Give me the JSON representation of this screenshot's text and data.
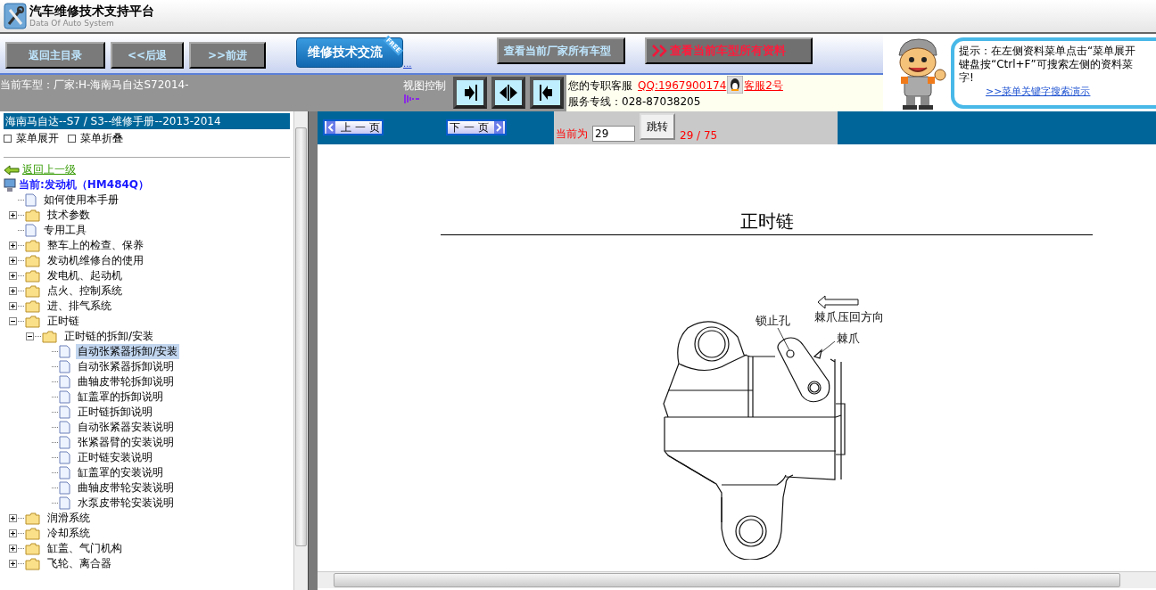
{
  "header": {
    "title": "汽车维修技术支持平台",
    "subtitle": "Data Of Auto System"
  },
  "nav_buttons": [
    {
      "label": "返回主目录"
    },
    {
      "label": "<<后退"
    },
    {
      "label": ">>前进"
    }
  ],
  "forum_button": {
    "label": "维修技术交流",
    "badge": "FREE"
  },
  "more_link": "...",
  "model_buttons": [
    {
      "label": "查看当前厂家所有车型",
      "kind": "plain"
    },
    {
      "label": "查看当前车型所有资料",
      "kind": "highlight"
    }
  ],
  "current_model": "当前车型：厂家:H-海南马自达S72014-",
  "view_control": {
    "label": "视图控制",
    "buttons": [
      {
        "kind": "right"
      },
      {
        "kind": "split"
      },
      {
        "kind": "left"
      }
    ]
  },
  "service": {
    "label": "您的专职客服",
    "qq": "QQ:1967900174",
    "agent": "客服2号",
    "hotline": "服务专线：028-87038205"
  },
  "tip": {
    "lines": [
      "提示：在左侧资料菜单点击“菜单展开",
      "键盘按“Ctrl+F”可搜索左侧的资料菜",
      "字!"
    ],
    "link": ">>菜单关键字搜索演示"
  },
  "sidebar": {
    "manual_title": "海南马自达--S7 / S3--维修手册--2013-2014",
    "actions": [
      "菜单展开",
      "菜单折叠"
    ],
    "back_link": "返回上一级",
    "current": "当前:发动机（HM484Q）",
    "tree": [
      {
        "kind": "doc",
        "label": "如何使用本手册",
        "selected": false
      },
      {
        "kind": "folder",
        "label": "技术参数",
        "expanded": false,
        "selected": false
      },
      {
        "kind": "doc",
        "label": "专用工具",
        "selected": false
      },
      {
        "kind": "folder",
        "label": "整车上的检查、保养",
        "expanded": false,
        "selected": false
      },
      {
        "kind": "folder",
        "label": "发动机维修台的使用",
        "expanded": false,
        "selected": false
      },
      {
        "kind": "folder",
        "label": "发电机、起动机",
        "expanded": false,
        "selected": false
      },
      {
        "kind": "folder",
        "label": "点火、控制系统",
        "expanded": false,
        "selected": false
      },
      {
        "kind": "folder",
        "label": "进、排气系统",
        "expanded": false,
        "selected": false
      },
      {
        "kind": "folder",
        "label": "正时链",
        "expanded": true,
        "selected": false,
        "children": [
          {
            "kind": "folder",
            "label": "正时链的拆卸/安装",
            "expanded": true,
            "selected": false,
            "children": [
              {
                "kind": "doc",
                "label": "自动张紧器拆卸/安装",
                "selected": true
              },
              {
                "kind": "doc",
                "label": "自动张紧器拆卸说明",
                "selected": false
              },
              {
                "kind": "doc",
                "label": "曲轴皮带轮拆卸说明",
                "selected": false
              },
              {
                "kind": "doc",
                "label": "缸盖罩的拆卸说明",
                "selected": false
              },
              {
                "kind": "doc",
                "label": "正时链拆卸说明",
                "selected": false
              },
              {
                "kind": "doc",
                "label": "自动张紧器安装说明",
                "selected": false
              },
              {
                "kind": "doc",
                "label": "张紧器臂的安装说明",
                "selected": false
              },
              {
                "kind": "doc",
                "label": "正时链安装说明",
                "selected": false
              },
              {
                "kind": "doc",
                "label": "缸盖罩的安装说明",
                "selected": false
              },
              {
                "kind": "doc",
                "label": "曲轴皮带轮安装说明",
                "selected": false
              },
              {
                "kind": "doc",
                "label": "水泵皮带轮安装说明",
                "selected": false
              }
            ]
          }
        ]
      },
      {
        "kind": "folder",
        "label": "润滑系统",
        "expanded": false,
        "selected": false
      },
      {
        "kind": "folder",
        "label": "冷却系统",
        "expanded": false,
        "selected": false
      },
      {
        "kind": "folder",
        "label": "缸盖、气门机构",
        "expanded": false,
        "selected": false
      },
      {
        "kind": "folder",
        "label": "飞轮、离合器",
        "expanded": false,
        "selected": false
      }
    ]
  },
  "pager": {
    "prev": "上 一 页",
    "next": "下 一 页",
    "current_label": "当前为",
    "page_input": "29",
    "jump_button": "跳转",
    "page_count": "29 / 75"
  },
  "document": {
    "title": "正时链",
    "figure_labels": {
      "lock_hole": "锁止孔",
      "pawl_direction": "棘爪压回方向",
      "pawl": "棘爪"
    }
  }
}
